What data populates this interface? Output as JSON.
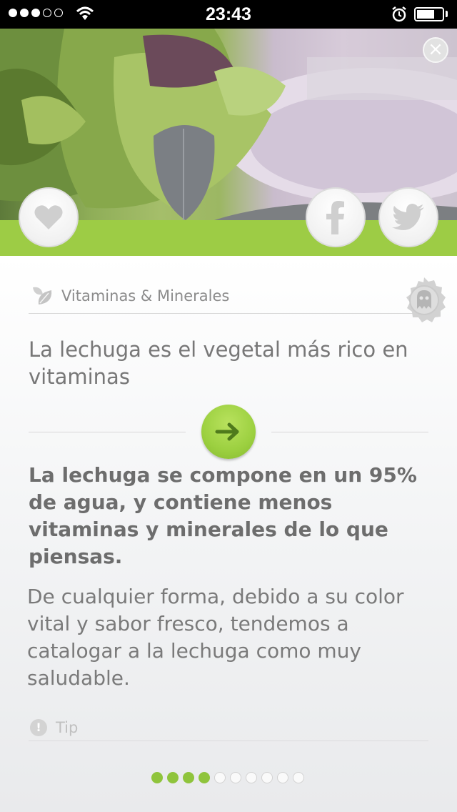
{
  "status_bar": {
    "time": "23:43",
    "signal_bars_filled": 3,
    "signal_bars_total": 5,
    "icons": [
      "wifi-icon",
      "alarm-icon",
      "battery-icon"
    ]
  },
  "hero": {
    "image": "salad-leaves-on-plate",
    "actions": [
      "close-icon",
      "heart-icon",
      "facebook-icon",
      "twitter-icon"
    ]
  },
  "card": {
    "category_icon": "leaf-icon",
    "category": "Vitaminas & Minerales",
    "badge_icon": "ghost-badge-icon",
    "title": "La lechuga es el vegetal más rico en vitaminas",
    "reveal_icon": "arrow-right-icon",
    "answer_bold": "La lechuga se compone en un 95% de agua, y contiene menos vitaminas y minerales de lo que piensas.",
    "answer_body": "De cualquier forma, debido a su color vital y sabor fresco, tendemos a catalogar a la lechuga como muy saludable.",
    "tip_icon": "exclamation-icon",
    "tip_label": "Tip"
  },
  "pager": {
    "current": 4,
    "total": 10
  },
  "colors": {
    "accent_green": "#9dcc45",
    "text_gray": "#777777",
    "status_bar": "#000000"
  }
}
